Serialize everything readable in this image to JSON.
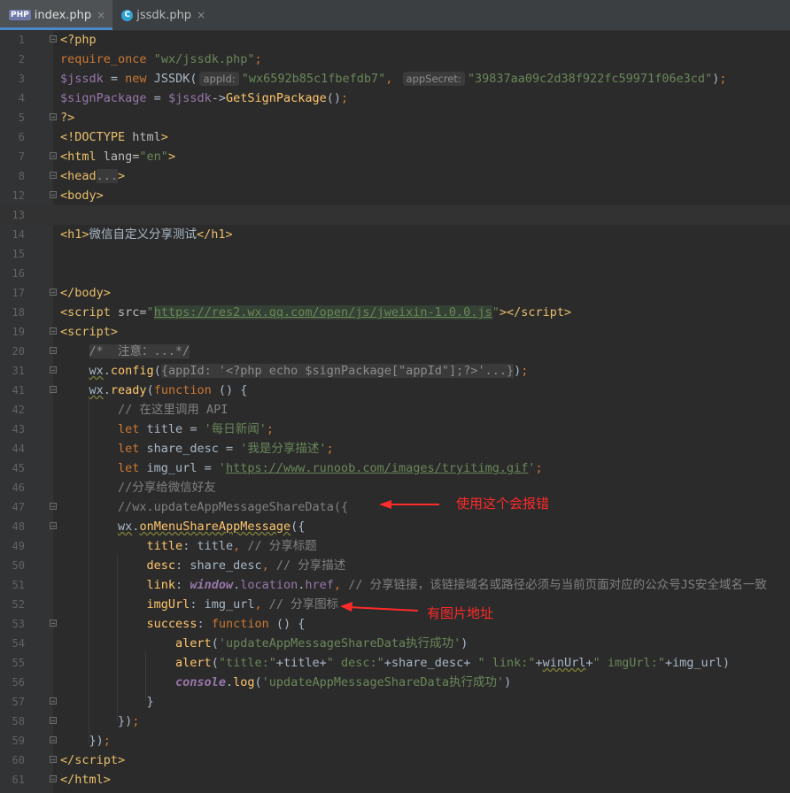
{
  "tabs": [
    {
      "name": "index.php",
      "icon": "php-file-icon",
      "active": true
    },
    {
      "name": "jssdk.php",
      "icon": "c-file-icon",
      "active": false
    }
  ],
  "icon_labels": {
    "php": "PHP",
    "c": "C",
    "close": "×",
    "fold": "−"
  },
  "lines": [
    {
      "n": "1",
      "html": "<span class=\"tag\">&lt;?php</span>"
    },
    {
      "n": "2",
      "html": "<span class=\"kw\">require_once</span> <span class=\"str\">\"wx/jssdk.php\"</span><span class=\"kw\">;</span>"
    },
    {
      "n": "3",
      "html": "<span class=\"var\">$jssdk</span> = <span class=\"kw\">new</span> JSSDK(<span class=\"hint\">appId:</span><span class=\"str\">\"wx6592b85c1fbefdb7\"</span><span class=\"kw\">,</span> <span class=\"hint\">appSecret:</span><span class=\"str\">\"39837aa09c2d38f922fc59971f06e3cd\"</span>)<span class=\"kw\">;</span>"
    },
    {
      "n": "4",
      "html": "<span class=\"var\">$signPackage</span> = <span class=\"var\">$jssdk</span>-&gt;<span class=\"fn\">GetSignPackage</span>()<span class=\"kw\">;</span>"
    },
    {
      "n": "5",
      "html": "<span class=\"tag\">?&gt;</span>"
    },
    {
      "n": "6",
      "html": "<span class=\"tag\">&lt;!DOCTYPE </span><span class=\"attr\">html</span><span class=\"tag\">&gt;</span>"
    },
    {
      "n": "7",
      "html": "<span class=\"tag\">&lt;html </span><span class=\"attr\">lang=</span><span class=\"str\">\"en\"</span><span class=\"tag\">&gt;</span>"
    },
    {
      "n": "8",
      "html": "<span class=\"tag\">&lt;head</span><span class=\"fold-region\">...</span><span class=\"tag\">&gt;</span>"
    },
    {
      "n": "12",
      "html": "<span class=\"tag\">&lt;body&gt;</span>"
    },
    {
      "n": "13",
      "html": ""
    },
    {
      "n": "14",
      "html": "<span class=\"tag\">&lt;h1&gt;</span>微信自定义分享测试<span class=\"tag\">&lt;/h1&gt;</span>"
    },
    {
      "n": "15",
      "html": ""
    },
    {
      "n": "16",
      "html": ""
    },
    {
      "n": "17",
      "html": "<span class=\"tag\">&lt;/body&gt;</span>"
    },
    {
      "n": "18",
      "html": "<span class=\"tag\">&lt;script </span><span class=\"attr\">src=</span><span class=\"str\">\"</span><span class=\"link\">https://res2.wx.qq.com/open/js/jweixin-1.0.0.js</span><span class=\"str\">\"</span><span class=\"tag\">&gt;&lt;/script&gt;</span>"
    },
    {
      "n": "19",
      "html": "<span class=\"tag\">&lt;script&gt;</span>"
    },
    {
      "n": "20",
      "html": "    <span class=\"fold-region\">/*  注意：...*/</span>"
    },
    {
      "n": "31",
      "html": "    <span class=\"wx\">wx</span>.<span class=\"fn\">config</span>(<span class=\"fold-region\">{appId: '&lt;?php echo $signPackage[\"appId\"];?&gt;'...}</span>)<span class=\"kw\">;</span>"
    },
    {
      "n": "41",
      "html": "    <span class=\"wx\">wx</span>.<span class=\"fn\">ready</span>(<span class=\"kw\">function</span> () {"
    },
    {
      "n": "42",
      "html": "        <span class=\"cm\">// 在这里调用 API</span>"
    },
    {
      "n": "43",
      "html": "        <span class=\"kw\">let</span> title = <span class=\"str\">'每日新闻'</span><span class=\"kw\">;</span>"
    },
    {
      "n": "44",
      "html": "        <span class=\"kw\">let</span> share_desc = <span class=\"str\">'我是分享描述'</span><span class=\"kw\">;</span>"
    },
    {
      "n": "45",
      "html": "        <span class=\"kw\">let</span> img_url = <span class=\"str\">'<u>https://www.runoob.com/images/tryitimg.gif</u>'</span><span class=\"kw\">;</span>"
    },
    {
      "n": "46",
      "html": "        <span class=\"cm\">//分享给微信好友</span>"
    },
    {
      "n": "47",
      "html": "        <span class=\"cm\">//wx.updateAppMessageShareData({</span>"
    },
    {
      "n": "48",
      "html": "        <span class=\"wx\">wx</span>.<span class=\"fn\" style=\"text-decoration:underline wavy #7a7a3a\">onMenuShareAppMessage</span>({"
    },
    {
      "n": "49",
      "html": "            <span class=\"fn\">title</span>: title<span class=\"kw\">,</span> <span class=\"cm\">// 分享标题</span>"
    },
    {
      "n": "50",
      "html": "            <span class=\"fn\">desc</span>: share_desc<span class=\"kw\">,</span> <span class=\"cm\">// 分享描述</span>"
    },
    {
      "n": "51",
      "html": "            <span class=\"fn\">link</span>: <span class=\"purple-i\">window</span>.<span class=\"var\">location</span>.<span class=\"var\">href</span><span class=\"kw\">,</span> <span class=\"cm\">// 分享链接，该链接域名或路径必须与当前页面对应的公众号JS安全域名一致</span>"
    },
    {
      "n": "52",
      "html": "            <span class=\"fn\">imgUrl</span>: img_url<span class=\"kw\">,</span> <span class=\"cm\">// 分享图标</span>"
    },
    {
      "n": "53",
      "html": "            <span class=\"fn\">success</span>: <span class=\"kw\">function</span> () {"
    },
    {
      "n": "54",
      "html": "                <span class=\"fn\">alert</span>(<span class=\"str\">'updateAppMessageShareData执行成功'</span>)"
    },
    {
      "n": "55",
      "html": "                <span class=\"fn\">alert</span>(<span class=\"str\">\"title:\"</span>+title+<span class=\"str\">\" desc:\"</span>+share_desc+ <span class=\"str\">\" link:\"</span>+<span class=\"wx\">winUrl</span>+<span class=\"str\">\" imgUrl:\"</span>+img_url)"
    },
    {
      "n": "56",
      "html": "                <span class=\"purple-i\">console</span>.<span class=\"fn\">log</span>(<span class=\"str\">'updateAppMessageShareData执行成功'</span>)"
    },
    {
      "n": "57",
      "html": "            }"
    },
    {
      "n": "58",
      "html": "        })<span class=\"kw\">;</span>"
    },
    {
      "n": "59",
      "html": "    })<span class=\"kw\">;</span>"
    },
    {
      "n": "60",
      "html": "<span class=\"tag\">&lt;/script&gt;</span>"
    },
    {
      "n": "61",
      "html": "<span class=\"tag\">&lt;/html&gt;</span>"
    }
  ],
  "annotations": [
    {
      "text": "使用这个会报错"
    },
    {
      "text": "有图片地址"
    }
  ],
  "colors": {
    "editor_bg": "#2b2b2b",
    "gutter_bg": "#313335",
    "annotation": "#ff2a2a"
  }
}
